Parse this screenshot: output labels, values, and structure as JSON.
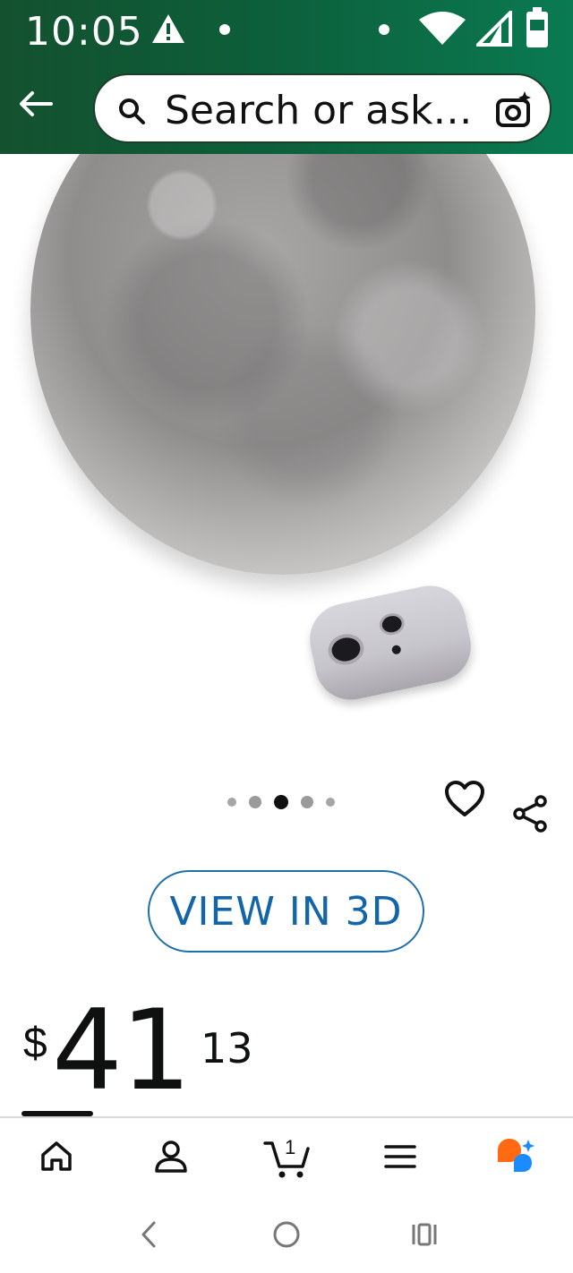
{
  "status_bar": {
    "time": "10:05",
    "icons": [
      "alert-icon",
      "dot-icon",
      "dot-icon",
      "wifi-icon",
      "signal-icon",
      "battery-icon"
    ]
  },
  "search": {
    "placeholder": "Search or ask…",
    "icons": [
      "back-arrow-icon",
      "search-icon",
      "camera-icon"
    ]
  },
  "product": {
    "image_alt": "Moon lamp with remote",
    "carousel": {
      "total_dots": 5,
      "active_index": 2
    },
    "view_3d_label": "VIEW IN 3D",
    "price": {
      "symbol": "$",
      "whole": "41",
      "fraction": "13"
    }
  },
  "bottom_nav": {
    "items": [
      {
        "name": "home",
        "icon": "home-icon",
        "active": true
      },
      {
        "name": "account",
        "icon": "person-icon"
      },
      {
        "name": "cart",
        "icon": "cart-icon",
        "count": "1"
      },
      {
        "name": "menu",
        "icon": "menu-icon"
      },
      {
        "name": "assistant",
        "icon": "rufus-icon"
      }
    ]
  },
  "colors": {
    "header_bg": "#0d5e3a",
    "link_blue": "#1265a8",
    "assistant_orange": "#ff6a13",
    "assistant_blue": "#1a8cff"
  }
}
